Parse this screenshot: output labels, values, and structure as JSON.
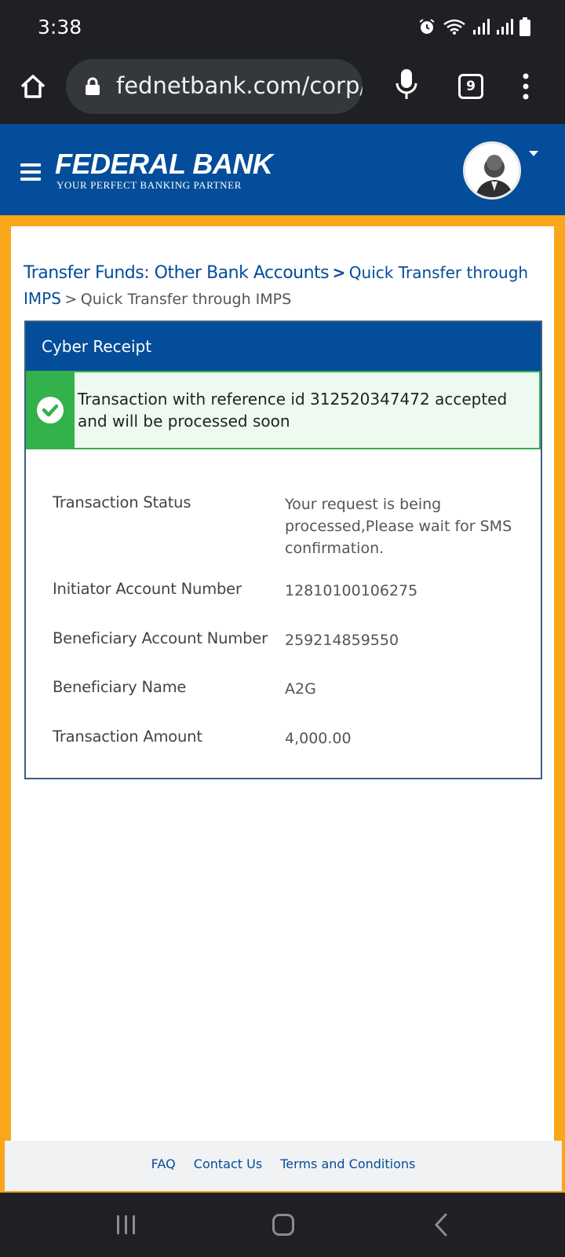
{
  "status_bar": {
    "time": "3:38"
  },
  "browser": {
    "url": "fednetbank.com/corp/",
    "tab_count": "9"
  },
  "header": {
    "brand": "FEDERAL BANK",
    "tagline": "YOUR PERFECT BANKING PARTNER"
  },
  "breadcrumb": {
    "main": "Transfer Funds: Other Bank Accounts",
    "sep1": ">",
    "sub": "Quick Transfer through IMPS",
    "sep2": ">",
    "current": "Quick Transfer through IMPS"
  },
  "receipt": {
    "title": "Cyber Receipt",
    "alert_message": "Transaction with reference id 312520347472 accepted and will be processed soon",
    "details": [
      {
        "label": "Transaction Status",
        "value": "Your request is being processed,Please wait for SMS confirmation."
      },
      {
        "label": "Initiator Account Number",
        "value": "12810100106275"
      },
      {
        "label": "Beneficiary Account Number",
        "value": "259214859550"
      },
      {
        "label": "Beneficiary Name",
        "value": "A2G"
      },
      {
        "label": "Transaction Amount",
        "value": "4,000.00"
      }
    ]
  },
  "footer": {
    "links": [
      "FAQ",
      "Contact Us",
      "Terms and Conditions"
    ]
  },
  "colors": {
    "brand_blue": "#034d9a",
    "frame_orange": "#f9a61b",
    "success_green": "#33b14b"
  },
  "icons": [
    "home-icon",
    "lock-icon",
    "mic-icon",
    "tabs-icon",
    "more-icon",
    "menu-icon",
    "avatar-icon",
    "check-icon",
    "alarm-icon",
    "wifi-icon",
    "signal-icon",
    "battery-icon"
  ]
}
